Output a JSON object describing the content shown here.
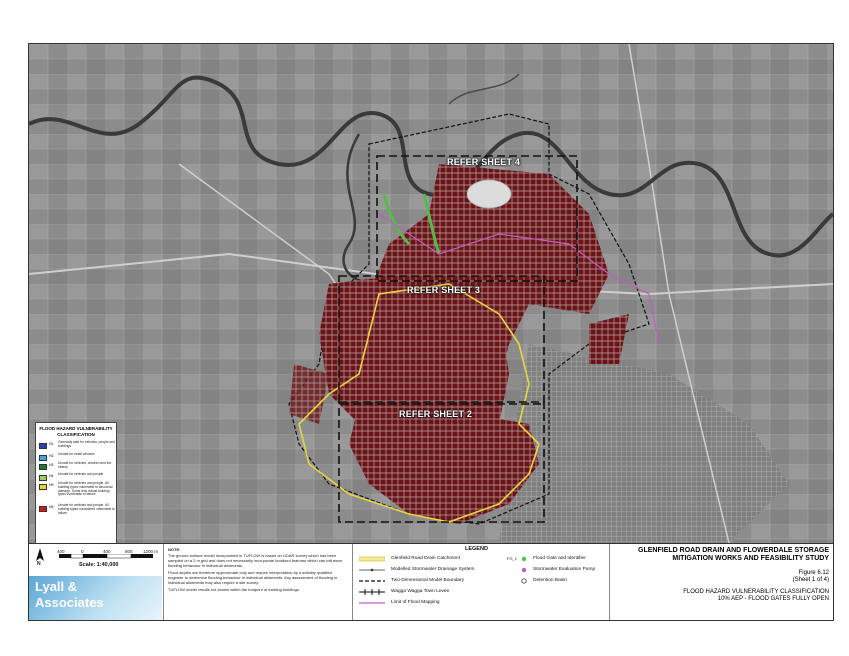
{
  "map": {
    "refer_labels": [
      "REFER SHEET 4",
      "REFER SHEET 3",
      "REFER SHEET 2"
    ]
  },
  "hazard_legend": {
    "title_line1": "FLOOD HAZARD VULNERABILITY",
    "title_line2": "CLASSIFICATION",
    "classes": [
      {
        "code": "H1",
        "color": "#2b3fb0",
        "desc": "Generally safe for vehicles, people and buildings"
      },
      {
        "code": "H2",
        "color": "#3fa6e0",
        "desc": "Unsafe for small vehicles"
      },
      {
        "code": "H3",
        "color": "#1e7a2e",
        "desc": "Unsafe for vehicles, children and the elderly"
      },
      {
        "code": "H4",
        "color": "#9ccf5a",
        "desc": "Unsafe for vehicles and people"
      },
      {
        "code": "H5",
        "color": "#e6d23a",
        "desc": "Unsafe for vehicles and people. All building types vulnerable to structural damage. Some less robust building types vulnerable to failure"
      },
      {
        "code": "H6",
        "color": "#d01818",
        "desc": "Unsafe for vehicles and people. All building types considered vulnerable to failure"
      }
    ]
  },
  "scale": {
    "ticks": [
      "400",
      "0",
      "400",
      "800",
      "1200 m"
    ],
    "label": "Scale: 1:40,000",
    "north": "N"
  },
  "brand": {
    "line1": "Lyall &",
    "line2": "Associates"
  },
  "note": {
    "heading": "NOTE:",
    "p1": "The ground surface model incorporated in TUFLOW is based on LiDAR survey which has been sampled on a 2 m grid and does not necessarily incorporate localised features which can influence flooding behaviour in individual allotments.",
    "p2": "Flood depths are therefore approximate only and require interpretation by a suitably qualified engineer to determine flooding behaviour in individual allotments. Any assessment of flooding in individual allotments may also require a site survey.",
    "p3": "TUFLOW model results not shown within the footprint of existing buildings."
  },
  "legend": {
    "heading": "LEGEND",
    "items": [
      "Glenfield Road Drain Catchment",
      "Modelled Stormwater Drainage System",
      "Two-Dimensional Model Boundary",
      "Wagga Wagga Town Levee",
      "Limit of Flood Mapping"
    ],
    "flood_gate_code": "FG_1",
    "flood_gate_label": "Flood Gate and Identifier",
    "pump_label": "Stormwater Evaluation Pump",
    "basin_label": "Detention Basin"
  },
  "title_block": {
    "line1": "GLENFIELD ROAD DRAIN AND FLOWERDALE STORAGE",
    "line2": "MITIGATION WORKS AND FEASIBILITY STUDY",
    "figure": "Figure 6.12",
    "sheet": "(Sheet 1 of 4)",
    "sub1": "FLOOD HAZARD VULNERABILITY CLASSIFICATION",
    "sub2": "10% AEP - FLOOD GATES FULLY OPEN"
  },
  "colors": {
    "map_base": "#8e8e8e",
    "urban_red": "#6b1418",
    "catchment_yellow": "#e8d640",
    "river_dark": "#3a3a3a",
    "pink_limit": "#c45cc0"
  }
}
